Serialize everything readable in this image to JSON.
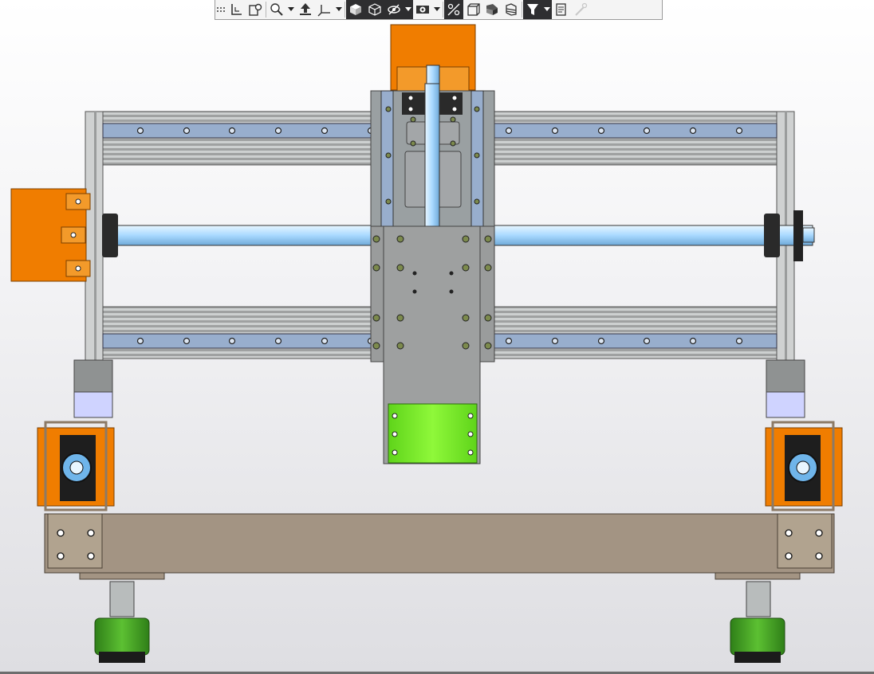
{
  "window": {
    "type": "cad-3d-viewport",
    "background_top": "#ffffff",
    "background_bottom": "#dedee2"
  },
  "toolbar": {
    "buttons": [
      {
        "name": "grip-icon"
      },
      {
        "name": "display-origin-icon"
      },
      {
        "name": "zoom-to-fit-icon"
      },
      {
        "name": "zoom-area-icon",
        "dropdown": true
      },
      {
        "name": "rotate-view-icon"
      },
      {
        "name": "triad-orientation-icon",
        "dropdown": true
      },
      {
        "name": "shaded-cube-icon",
        "active": true
      },
      {
        "name": "wireframe-cube-icon",
        "active": true
      },
      {
        "name": "hide-show-icon",
        "active": true,
        "dropdown": true
      },
      {
        "name": "display-style-icon",
        "dropdown": true
      },
      {
        "name": "section-view-icon",
        "active": true
      },
      {
        "name": "view-orientation-icon"
      },
      {
        "name": "apply-scene-icon"
      },
      {
        "name": "appearance-icon"
      },
      {
        "name": "filter-icon",
        "active": true,
        "dropdown": true
      },
      {
        "name": "view-settings-icon"
      },
      {
        "name": "pick-color-icon",
        "disabled": true
      }
    ]
  },
  "model": {
    "name": "cnc-router-gantry-assembly",
    "colors": {
      "frame_steel": "#c9cbcb",
      "rail_blue": "#98aecd",
      "motor_orange": "#f07d00",
      "ballscrew_blue": "#aedcff",
      "plate_gray": "#9a9a9a",
      "spindle_green": "#7ff42b",
      "base_beam": "#a39483",
      "foot_green": "#4aa728",
      "bolt_dark": "#222222"
    }
  }
}
